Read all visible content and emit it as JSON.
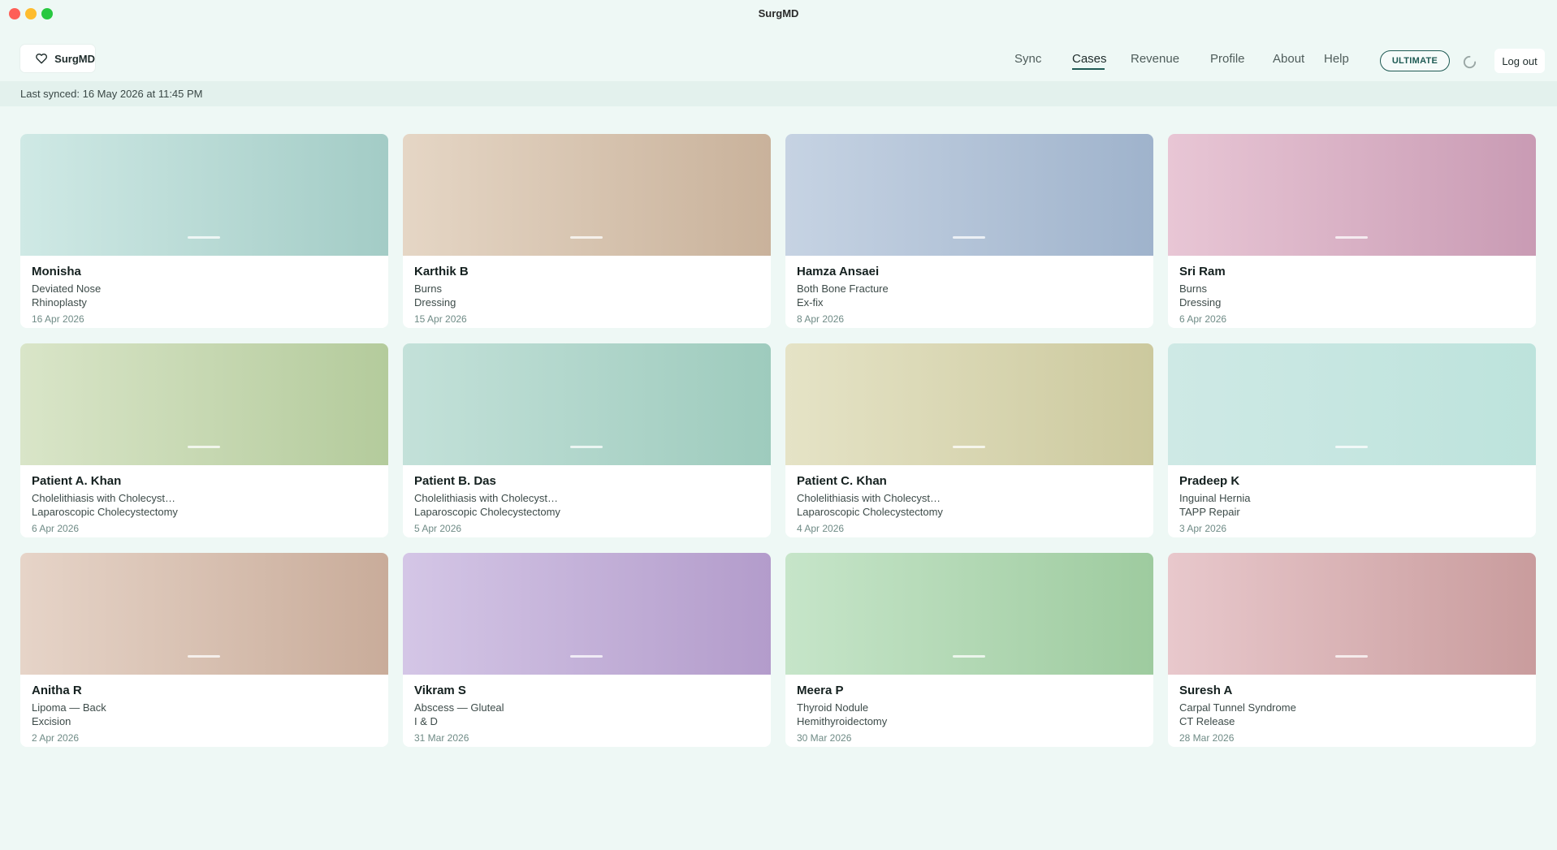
{
  "window": {
    "title": "SurgMD"
  },
  "brand": {
    "name": "SurgMD",
    "icon": "heart-icon"
  },
  "nav": {
    "items": [
      {
        "label": "Sync",
        "active": false
      },
      {
        "label": "Cases",
        "active": true
      },
      {
        "label": "Revenue",
        "active": false
      },
      {
        "label": "Profile",
        "active": false
      },
      {
        "label": "About",
        "active": false
      },
      {
        "label": "Help",
        "active": false
      }
    ],
    "ultimate_label": "ULTIMATE",
    "logout_label": "Log out",
    "accent_color": "#1f5a54"
  },
  "sync": {
    "text": "Last synced: 16 May 2026 at 11:45 PM"
  },
  "cases": [
    {
      "name": "Monisha",
      "diagnosis": "Deviated Nose",
      "procedure": "Rhinoplasty",
      "date": "16 Apr 2026",
      "color_from": "#cfe9e5",
      "color_to": "#a3ccc6"
    },
    {
      "name": "Karthik B",
      "diagnosis": "Burns",
      "procedure": "Dressing",
      "date": "15 Apr 2026",
      "color_from": "#e5d6c5",
      "color_to": "#c9b29b"
    },
    {
      "name": "Hamza Ansaei",
      "diagnosis": "Both Bone Fracture",
      "procedure": "Ex-fix",
      "date": "8 Apr 2026",
      "color_from": "#c6d3e3",
      "color_to": "#9fb3cc"
    },
    {
      "name": "Sri Ram",
      "diagnosis": "Burns",
      "procedure": "Dressing",
      "date": "6 Apr 2026",
      "color_from": "#e8c6d5",
      "color_to": "#c99bb4"
    },
    {
      "name": "Patient A. Khan",
      "diagnosis": "Cholelithiasis with Cholecyst…",
      "procedure": "Laparoscopic Cholecystectomy",
      "date": "6 Apr 2026",
      "color_from": "#d9e5c8",
      "color_to": "#b4cb9c"
    },
    {
      "name": "Patient B. Das",
      "diagnosis": "Cholelithiasis with Cholecyst…",
      "procedure": "Laparoscopic Cholecystectomy",
      "date": "5 Apr 2026",
      "color_from": "#c3e1d9",
      "color_to": "#9ecbbd"
    },
    {
      "name": "Patient C. Khan",
      "diagnosis": "Cholelithiasis with Cholecyst…",
      "procedure": "Laparoscopic Cholecystectomy",
      "date": "4 Apr 2026",
      "color_from": "#e5e3c6",
      "color_to": "#ccc99e"
    },
    {
      "name": "Pradeep K",
      "diagnosis": "Inguinal Hernia",
      "procedure": "TAPP Repair",
      "date": "3 Apr 2026",
      "color_from": "#cee9e5",
      "color_to": "#bde3dc"
    },
    {
      "name": "Anitha R",
      "diagnosis": "Lipoma — Back",
      "procedure": "Excision",
      "date": "2 Apr 2026",
      "color_from": "#e6d4c8",
      "color_to": "#c9ac9a"
    },
    {
      "name": "Vikram S",
      "diagnosis": "Abscess — Gluteal",
      "procedure": "I & D",
      "date": "31 Mar 2026",
      "color_from": "#d4c6e6",
      "color_to": "#b39ccb"
    },
    {
      "name": "Meera P",
      "diagnosis": "Thyroid Nodule",
      "procedure": "Hemithyroidectomy",
      "date": "30 Mar 2026",
      "color_from": "#c6e5c9",
      "color_to": "#9ecb9f"
    },
    {
      "name": "Suresh A",
      "diagnosis": "Carpal Tunnel Syndrome",
      "procedure": "CT Release",
      "date": "28 Mar 2026",
      "color_from": "#e8c8cc",
      "color_to": "#c99c9d"
    }
  ]
}
